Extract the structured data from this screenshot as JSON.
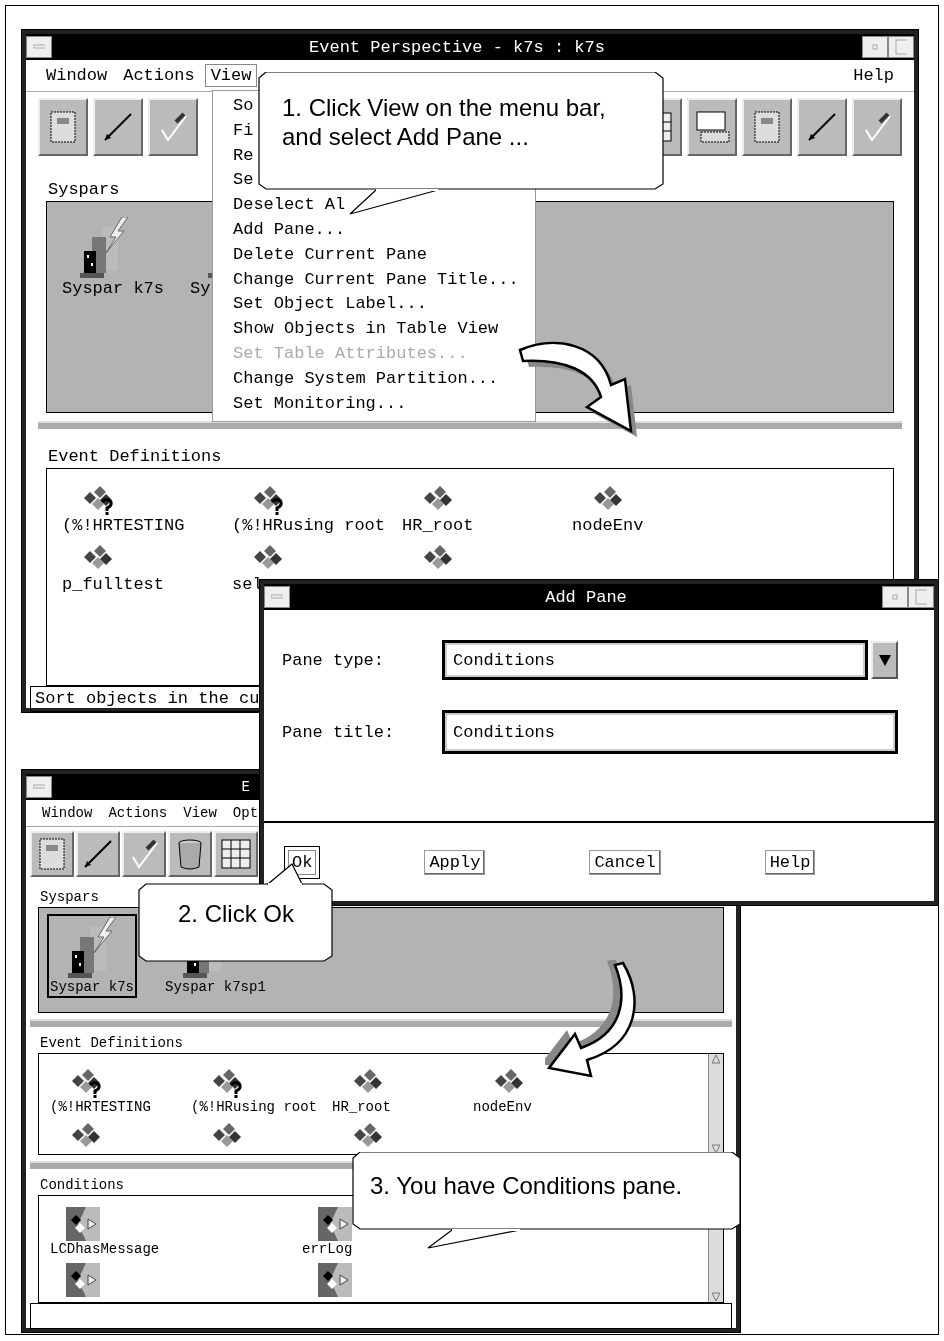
{
  "window_1": {
    "title": "Event Perspective - k7s : k7s",
    "menu": [
      {
        "label": "Window",
        "selected": false
      },
      {
        "label": "Actions",
        "selected": false
      },
      {
        "label": "View",
        "selected": true
      }
    ],
    "help_menu": "Help",
    "panes": [
      {
        "kind": "syspars",
        "title": "Syspars",
        "items": [
          {
            "label": "Syspar k7s"
          },
          {
            "label": "Sy"
          }
        ]
      },
      {
        "kind": "events",
        "title": "Event Definitions",
        "items": [
          {
            "label": "(%!HRTESTING",
            "kind": "question"
          },
          {
            "label": "(%!HRusing root",
            "kind": "question"
          },
          {
            "label": "HR_root",
            "kind": "plain"
          },
          {
            "label": "nodeEnv",
            "kind": "plain"
          },
          {
            "label": "p_fulltest",
            "kind": "plain"
          },
          {
            "label": "sel",
            "kind": "plain"
          },
          {
            "kind": "plain"
          }
        ]
      }
    ],
    "status_bar": "Sort objects in the cu"
  },
  "view_menu": {
    "items": [
      {
        "label": "So",
        "disabled": false
      },
      {
        "label": "Fi",
        "disabled": false
      },
      {
        "label": "Re",
        "disabled": false
      },
      {
        "label": "Se",
        "disabled": false
      },
      {
        "label": "Deselect Al",
        "disabled": false
      },
      {
        "label": "Add Pane...",
        "disabled": false
      },
      {
        "label": "Delete Current Pane",
        "disabled": false
      },
      {
        "label": "Change Current Pane Title...",
        "disabled": false
      },
      {
        "label": "Set Object Label...",
        "disabled": false
      },
      {
        "label": "Show Objects in Table View",
        "disabled": false
      },
      {
        "label": "Set Table Attributes...",
        "disabled": true
      },
      {
        "label": "Change System Partition...",
        "disabled": false
      },
      {
        "label": "Set Monitoring...",
        "disabled": false
      }
    ]
  },
  "add_pane_dialog": {
    "title": "Add Pane",
    "fields": [
      {
        "kind": "combo",
        "label": "Pane type:",
        "value": "Conditions"
      },
      {
        "kind": "text",
        "label": "Pane title:",
        "value": "Conditions"
      }
    ],
    "buttons": [
      {
        "label": "Ok",
        "selected": true
      },
      {
        "label": "Apply",
        "selected": false
      },
      {
        "label": "Cancel",
        "selected": false
      },
      {
        "label": "Help",
        "selected": false
      }
    ]
  },
  "window_2": {
    "title": "E",
    "menu": [
      {
        "label": "Window",
        "selected": false
      },
      {
        "label": "Actions",
        "selected": false
      },
      {
        "label": "View",
        "selected": false
      },
      {
        "label": "Opt",
        "selected": false
      }
    ],
    "panes": [
      {
        "kind": "syspars",
        "title": "Syspars",
        "items": [
          {
            "label": "Syspar k7s",
            "selected": true
          },
          {
            "label": "Syspar k7sp1",
            "selected": false
          }
        ]
      },
      {
        "kind": "events",
        "title": "Event Definitions",
        "scrollable": true,
        "items": [
          {
            "label": "(%!HRTESTING",
            "kind": "question"
          },
          {
            "label": "(%!HRusing root",
            "kind": "question"
          },
          {
            "label": "HR_root",
            "kind": "plain"
          },
          {
            "label": "nodeEnv",
            "kind": "plain"
          },
          {
            "kind": "plain"
          },
          {
            "kind": "plain"
          },
          {
            "kind": "plain"
          }
        ]
      },
      {
        "kind": "conditions",
        "title": "Conditions",
        "scrollable": true,
        "items": [
          {
            "label": "LCDhasMessage",
            "kind": "condition"
          },
          {
            "label": "errLog",
            "kind": "condition"
          },
          {
            "kind": "condition"
          },
          {
            "kind": "condition"
          }
        ]
      }
    ]
  },
  "callouts": [
    {
      "text": "1. Click View on the menu bar, and select Add Pane ..."
    },
    {
      "text": "2. Click Ok"
    },
    {
      "text": "3. You have Conditions pane."
    }
  ]
}
